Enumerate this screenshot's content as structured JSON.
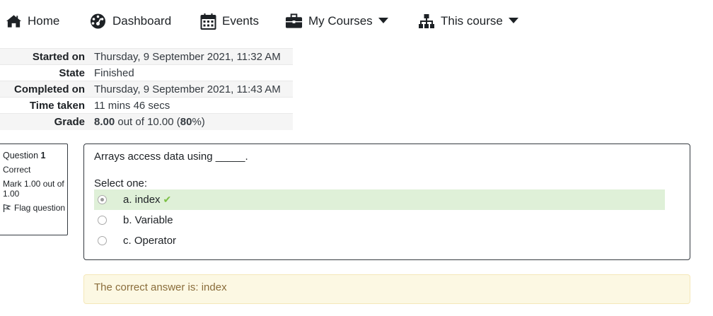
{
  "nav": {
    "home": "Home",
    "dashboard": "Dashboard",
    "events": "Events",
    "my_courses": "My Courses",
    "this_course": "This course"
  },
  "summary": {
    "rows": [
      {
        "label": "Started on",
        "value": "Thursday, 9 September 2021, 11:32 AM"
      },
      {
        "label": "State",
        "value": "Finished"
      },
      {
        "label": "Completed on",
        "value": "Thursday, 9 September 2021, 11:43 AM"
      },
      {
        "label": "Time taken",
        "value": "11 mins 46 secs"
      }
    ],
    "grade_label": "Grade",
    "grade_score": "8.00",
    "grade_mid": " out of 10.00 (",
    "grade_percent": "80",
    "grade_end": "%)"
  },
  "question": {
    "label": "Question",
    "number": "1",
    "status": "Correct",
    "mark": "Mark 1.00 out of 1.00",
    "flag": "Flag question",
    "text": "Arrays access data using _____.",
    "prompt": "Select one:",
    "answers": [
      {
        "label": "a. index",
        "selected": true,
        "correct": true
      },
      {
        "label": "b. Variable",
        "selected": false,
        "correct": false
      },
      {
        "label": "c. Operator",
        "selected": false,
        "correct": false
      }
    ],
    "feedback": "The correct answer is: index"
  },
  "colors": {
    "correct_bg": "#dff0d8",
    "feedback_bg": "#fcf8e3",
    "feedback_text": "#8a6d3b",
    "tick": "#7bbf44"
  }
}
